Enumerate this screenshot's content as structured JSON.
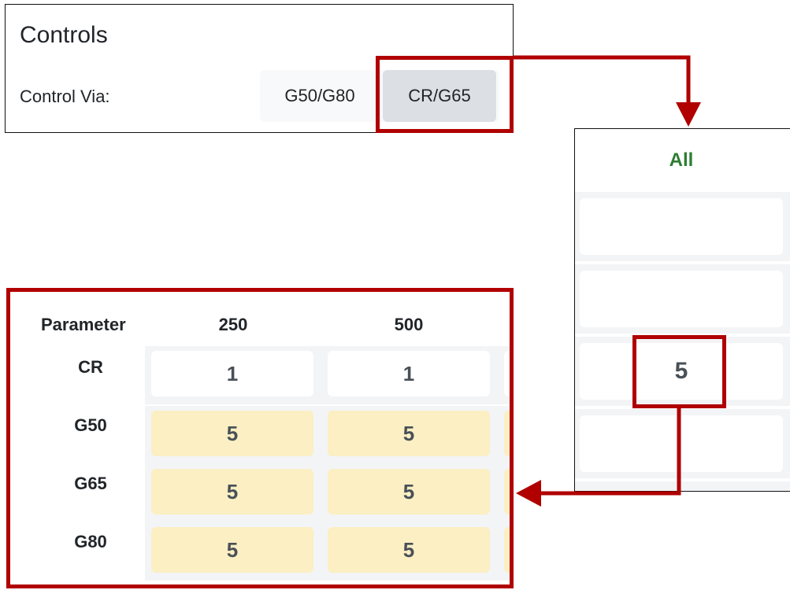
{
  "controls": {
    "title": "Controls",
    "label": "Control Via:",
    "options": [
      "G50/G80",
      "CR/G65"
    ],
    "selected": "CR/G65"
  },
  "all_panel": {
    "header": "All",
    "highlighted_value": "5"
  },
  "table": {
    "parameter_header": "Parameter",
    "columns": [
      "250",
      "500"
    ],
    "rows": [
      {
        "label": "CR",
        "values": [
          "1",
          "1"
        ],
        "highlight": false
      },
      {
        "label": "G50",
        "values": [
          "5",
          "5"
        ],
        "highlight": true
      },
      {
        "label": "G65",
        "values": [
          "5",
          "5"
        ],
        "highlight": true
      },
      {
        "label": "G80",
        "values": [
          "5",
          "5"
        ],
        "highlight": true
      }
    ]
  },
  "colors": {
    "annotation_red": "#b00000",
    "header_green": "#2e7d32",
    "cell_highlight": "#fbefc3",
    "selected_button": "#dcdfe3"
  }
}
